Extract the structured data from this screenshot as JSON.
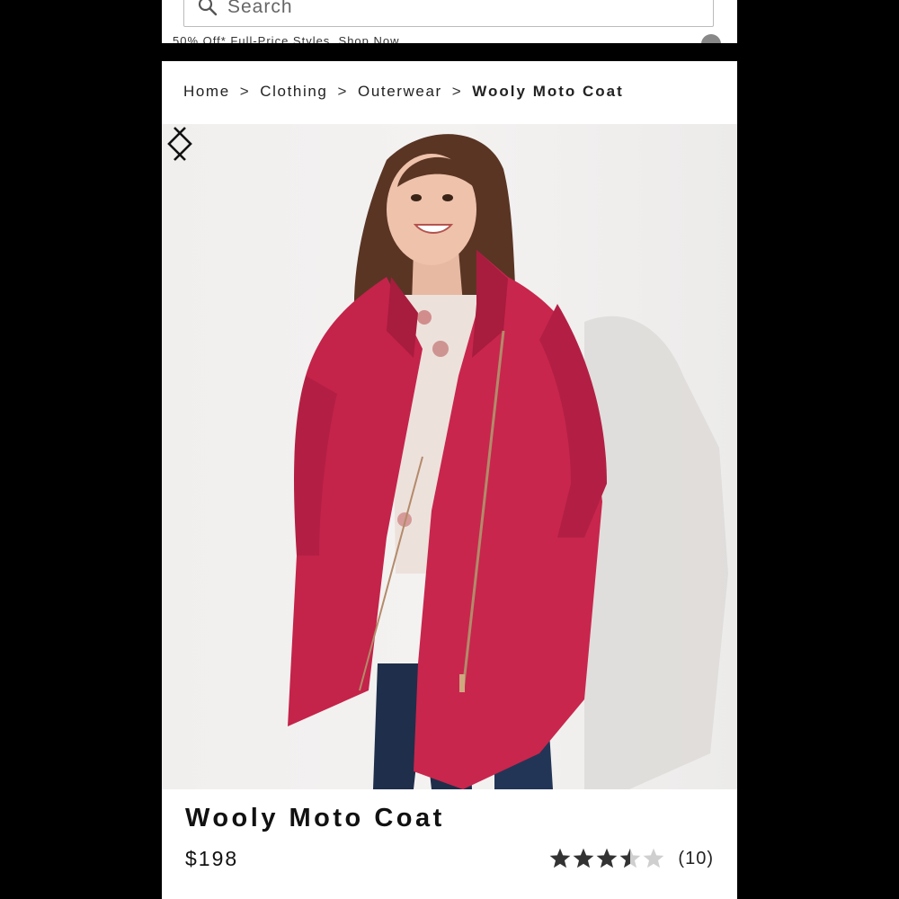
{
  "search": {
    "placeholder": "Search"
  },
  "promo": {
    "text": "50% Off* Full-Price Styles. Shop Now"
  },
  "breadcrumb": {
    "items": [
      "Home",
      "Clothing",
      "Outerwear"
    ],
    "separator": ">",
    "current": "Wooly Moto Coat"
  },
  "product": {
    "title": "Wooly Moto Coat",
    "price": "$198",
    "rating": 3.5,
    "rating_max": 5,
    "review_count": "(10)",
    "color_accent": "#c8264a"
  },
  "icons": {
    "search": "search-icon",
    "prev": "chevron-left-icon",
    "next": "chevron-right-icon",
    "star": "star-icon"
  }
}
